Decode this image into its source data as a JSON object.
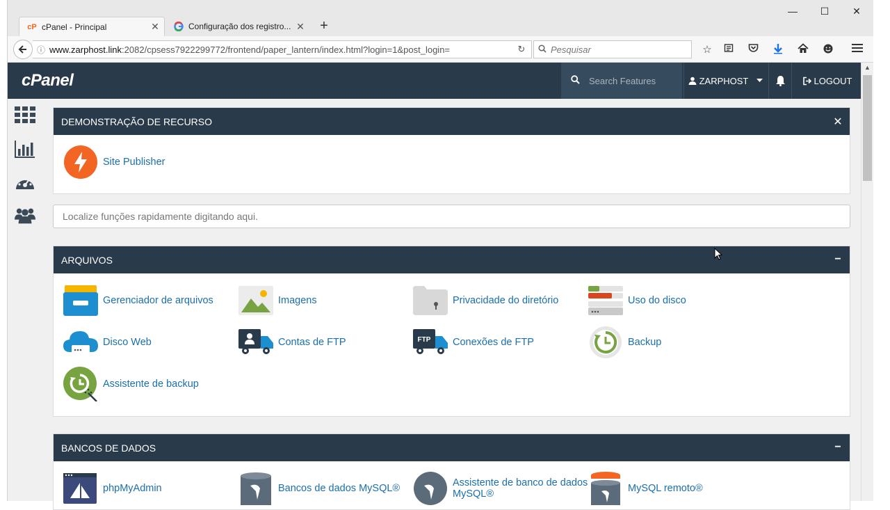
{
  "browser": {
    "tabs": [
      {
        "title": "cPanel - Principal",
        "active": true
      },
      {
        "title": "Configuração dos registro..."
      }
    ],
    "url_host": "www.zarphost.link",
    "url_rest": ":2082/cpsess7922299772/frontend/paper_lantern/index.html?login=1&post_login=",
    "search_placeholder": "Pesquisar"
  },
  "cpanel": {
    "logo": "cPanel",
    "search_placeholder": "Search Features",
    "user": "ZARPHOST",
    "logout": "LOGOUT",
    "quick_search_placeholder": "Localize funções rapidamente digitando aqui.",
    "panels": {
      "demo": {
        "title": "DEMONSTRAÇÃO DE RECURSO",
        "items": [
          {
            "label": "Site Publisher",
            "icon": "site-publisher-icon"
          }
        ]
      },
      "files": {
        "title": "ARQUIVOS",
        "items": [
          {
            "label": "Gerenciador de arquivos",
            "icon": "file-manager-icon"
          },
          {
            "label": "Imagens",
            "icon": "images-icon"
          },
          {
            "label": "Privacidade do diretório",
            "icon": "directory-privacy-icon"
          },
          {
            "label": "Uso do disco",
            "icon": "disk-usage-icon"
          },
          {
            "label": "Disco Web",
            "icon": "web-disk-icon"
          },
          {
            "label": "Contas de FTP",
            "icon": "ftp-accounts-icon"
          },
          {
            "label": "Conexões de FTP",
            "icon": "ftp-connections-icon"
          },
          {
            "label": "Backup",
            "icon": "backup-icon"
          },
          {
            "label": "Assistente de backup",
            "icon": "backup-wizard-icon"
          }
        ]
      },
      "databases": {
        "title": "BANCOS DE DADOS",
        "items": [
          {
            "label": "phpMyAdmin",
            "icon": "phpmyadmin-icon"
          },
          {
            "label": "Bancos de dados MySQL®",
            "icon": "mysql-databases-icon"
          },
          {
            "label": "Assistente de banco de dados MySQL®",
            "icon": "mysql-wizard-icon"
          },
          {
            "label": "MySQL remoto®",
            "icon": "remote-mysql-icon"
          }
        ]
      }
    }
  },
  "colors": {
    "header": "#293a4a",
    "link": "#1b6fab",
    "accent_orange": "#f26522"
  }
}
